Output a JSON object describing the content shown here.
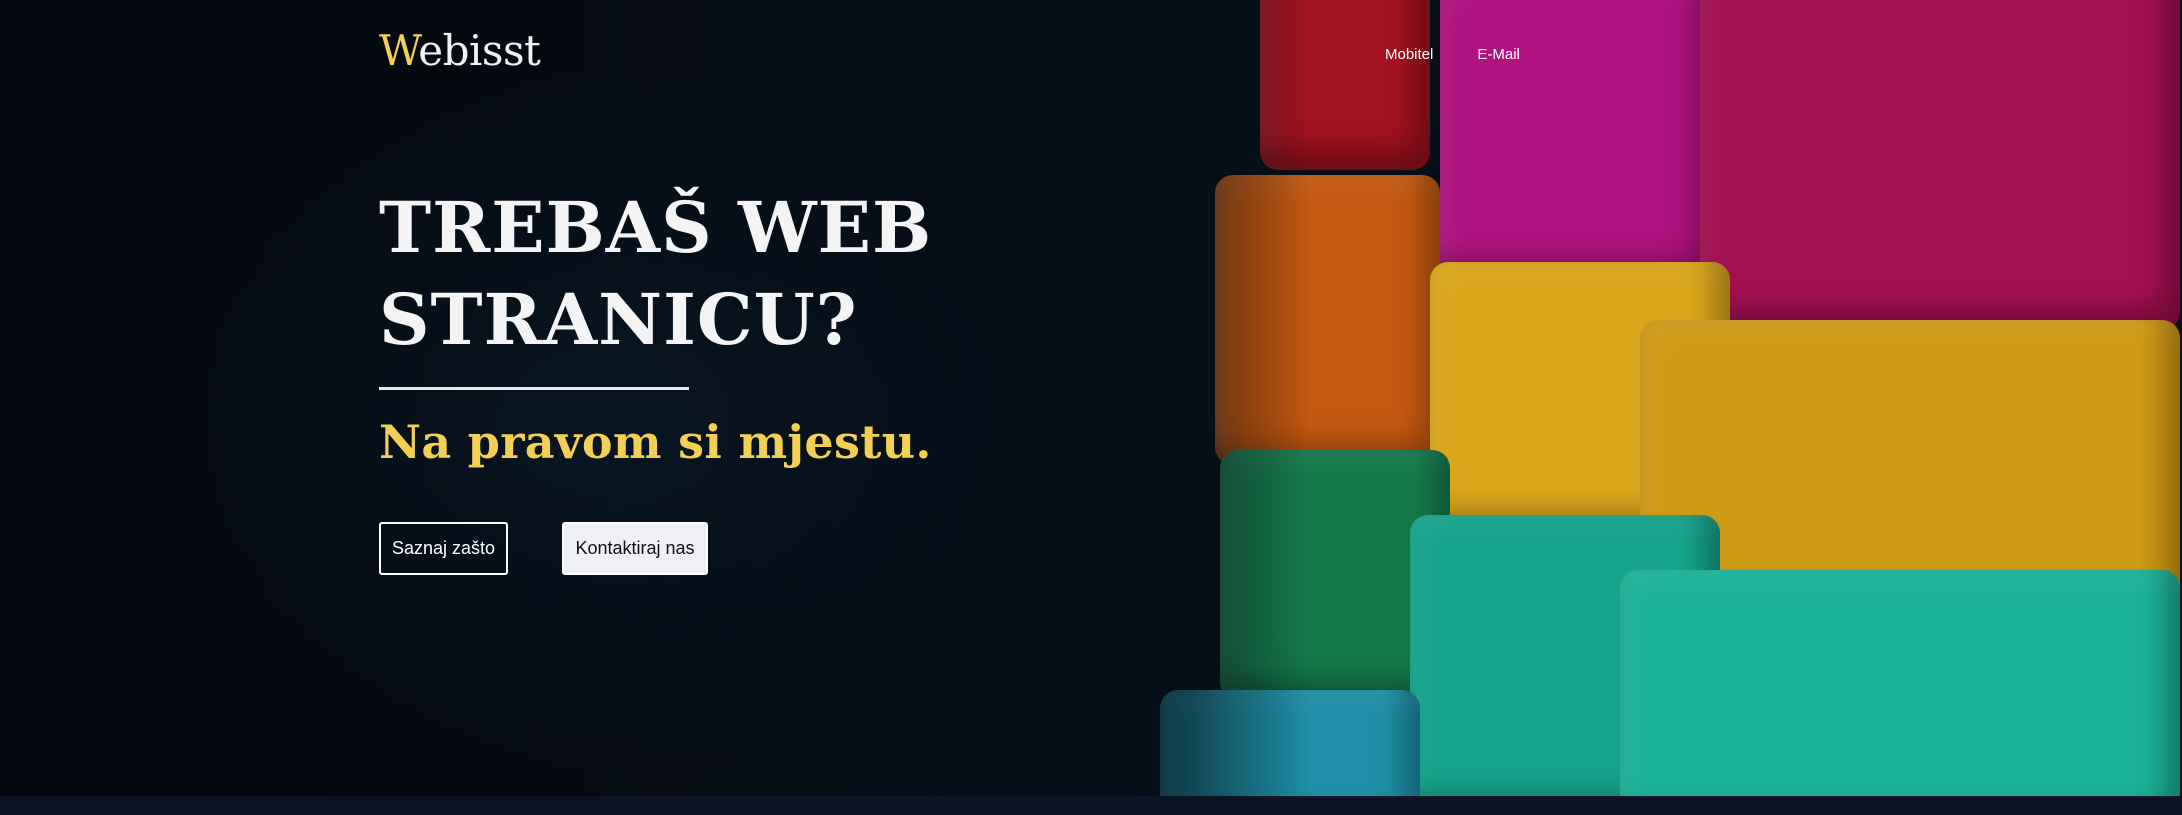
{
  "nav": {
    "logo_initial": "W",
    "logo_rest": "ebisst",
    "links": [
      {
        "label": "Mobitel"
      },
      {
        "label": "E-Mail"
      }
    ]
  },
  "hero": {
    "headline_line1": "TREBAŠ WEB",
    "headline_line2": "STRANICU?",
    "subheadline": "Na pravom si mjestu.",
    "buttons": {
      "primary_label": "Saznaj zašto",
      "secondary_label": "Kontaktiraj nas"
    }
  },
  "colors": {
    "accent": "#f4cf55",
    "background": "#050b16",
    "text": "#f4f4f4"
  }
}
